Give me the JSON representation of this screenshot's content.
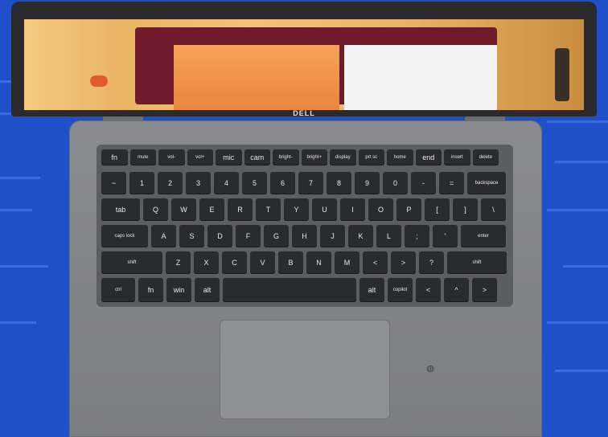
{
  "brand_logo": "DELL",
  "colors": {
    "background": "#1f4fc9",
    "deck": "#858689",
    "key": "#2a2b2d"
  },
  "function_row": [
    "fn",
    "mute",
    "vol-",
    "vol+",
    "mic",
    "cam",
    "bright-",
    "bright+",
    "display",
    "prt sc",
    "home",
    "end",
    "insert",
    "delete"
  ],
  "number_row": [
    "~",
    "1",
    "2",
    "3",
    "4",
    "5",
    "6",
    "7",
    "8",
    "9",
    "0",
    "-",
    "=",
    "backspace"
  ],
  "qwerty_row": [
    "tab",
    "Q",
    "W",
    "E",
    "R",
    "T",
    "Y",
    "U",
    "I",
    "O",
    "P",
    "[",
    "]",
    "\\"
  ],
  "home_row": [
    "caps lock",
    "A",
    "S",
    "D",
    "F",
    "G",
    "H",
    "J",
    "K",
    "L",
    ";",
    "'",
    "enter"
  ],
  "shift_row": [
    "shift",
    "Z",
    "X",
    "C",
    "V",
    "B",
    "N",
    "M",
    "<",
    ">",
    "?",
    "shift"
  ],
  "bottom_row": [
    "ctrl",
    "fn",
    "win",
    "alt",
    "",
    "alt",
    "copilot",
    "<",
    "^",
    ">"
  ],
  "fingerprint_icon": "fingerprint-icon"
}
